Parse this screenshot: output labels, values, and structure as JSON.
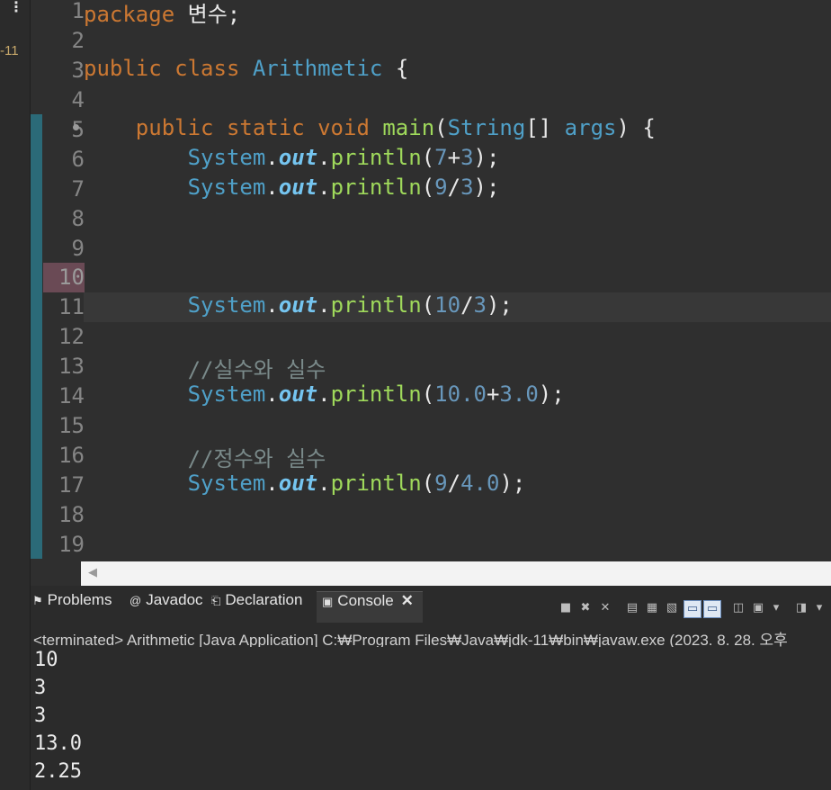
{
  "left_strip": {
    "menu_glyph": "⋮",
    "tag_text": "-11"
  },
  "editor": {
    "line_numbers": [
      "1",
      "2",
      "3",
      "4",
      "5",
      "6",
      "7",
      "8",
      "9",
      "10",
      "11",
      "12",
      "13",
      "14",
      "15",
      "16",
      "17",
      "18",
      "19"
    ],
    "line1": {
      "kw": "package",
      "name": "변수",
      "semi": ";"
    },
    "line3": {
      "kw1": "public",
      "kw2": "class",
      "cls": "Arithmetic",
      "brace": "{"
    },
    "line5": {
      "kw1": "public",
      "kw2": "static",
      "kw3": "void",
      "name": "main",
      "open": "(",
      "type": "String",
      "arr": "[]",
      "arg": "args",
      "close": ")",
      "brace": "{"
    },
    "line6": {
      "sys": "System",
      "dot1": ".",
      "out": "out",
      "dot2": ".",
      "m": "println",
      "o": "(",
      "a": "7",
      "op": "+",
      "b": "3",
      "c": ");"
    },
    "line7": {
      "sys": "System",
      "dot1": ".",
      "out": "out",
      "dot2": ".",
      "m": "println",
      "o": "(",
      "a": "9",
      "op": "/",
      "b": "3",
      "c": ");"
    },
    "line11": {
      "sys": "System",
      "dot1": ".",
      "out": "out",
      "dot2": ".",
      "m": "println",
      "o": "(",
      "a": "10",
      "op": "/",
      "b": "3",
      "c": ");"
    },
    "line13": {
      "comment": "//실수와 실수"
    },
    "line14": {
      "sys": "System",
      "dot1": ".",
      "out": "out",
      "dot2": ".",
      "m": "println",
      "o": "(",
      "a": "10.0",
      "op": "+",
      "b": "3.0",
      "c": ");"
    },
    "line16": {
      "comment": "//정수와 실수"
    },
    "line17": {
      "sys": "System",
      "dot1": ".",
      "out": "out",
      "dot2": ".",
      "m": "println",
      "o": "(",
      "a": "9",
      "op": "/",
      "b": "4.0",
      "c": ");"
    }
  },
  "scrollbar": {
    "left_arrow": "◀"
  },
  "bottom_panel": {
    "tabs": [
      {
        "label": "Problems",
        "icon": "problems-icon",
        "glyph": "⚑"
      },
      {
        "label": "Javadoc",
        "icon": "javadoc-icon",
        "glyph": "@"
      },
      {
        "label": "Declaration",
        "icon": "declaration-icon",
        "glyph": "⎗"
      },
      {
        "label": "Console",
        "icon": "console-icon",
        "glyph": "▣",
        "close": "✕"
      }
    ],
    "status_text": "<terminated> Arithmetic [Java Application] C:₩Program Files₩Java₩jdk-11₩bin₩javaw.exe  (2023. 8. 28. 오후",
    "output_lines": [
      "10",
      "3",
      "3",
      "13.0",
      "2.25"
    ]
  },
  "colors": {
    "keyword": "#cc7832",
    "type": "#4fa0c8",
    "method": "#9fd95b",
    "field": "#75c5f0",
    "number": "#6897bb",
    "comment": "#7a8a8a",
    "background": "#2f2f2f"
  }
}
